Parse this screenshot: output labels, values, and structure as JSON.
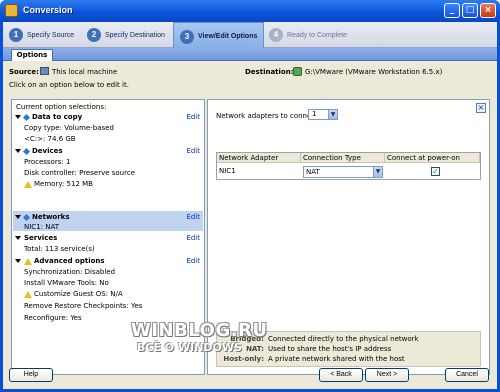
{
  "window": {
    "title": "Conversion"
  },
  "steps": [
    {
      "num": "1",
      "label": "Specify Source"
    },
    {
      "num": "2",
      "label": "Specify Destination"
    },
    {
      "num": "3",
      "label": "View/Edit Options"
    },
    {
      "num": "4",
      "label": "Ready to Complete"
    }
  ],
  "options_tab": "Options",
  "source": {
    "label": "Source:",
    "value": "This local machine"
  },
  "destination": {
    "label": "Destination:",
    "value": "G:\\VMware (VMware Workstation 6.5.x)"
  },
  "hint": "Click on an option below to edit it.",
  "left_panel": {
    "header": "Current option selections:",
    "edit_label": "Edit",
    "sections": {
      "data_to_copy": {
        "title": "Data to copy",
        "lines": [
          "Copy type: Volume-based",
          "<C:>: 74.6 GB"
        ]
      },
      "devices": {
        "title": "Devices",
        "lines": [
          "Processors: 1",
          "Disk controller: Preserve source",
          "Memory: 512 MB"
        ]
      },
      "networks": {
        "title": "Networks",
        "lines": [
          "NIC1: NAT"
        ]
      },
      "services": {
        "title": "Services",
        "lines": [
          "Total: 113 service(s)"
        ]
      },
      "advanced": {
        "title": "Advanced options",
        "lines": [
          "Synchronization: Disabled",
          "Install VMware Tools: No",
          "Customize Guest OS: N/A",
          "Remove Restore Checkpoints: Yes",
          "Reconfigure: Yes"
        ]
      }
    }
  },
  "right_panel": {
    "adapters_label": "Network adapters to connect:",
    "adapters_value": "1",
    "columns": [
      "Network Adapter",
      "Connection Type",
      "Connect at power-on"
    ],
    "rows": [
      {
        "adapter": "NIC1",
        "type": "NAT",
        "connect": true
      }
    ],
    "legend": [
      {
        "key": "Bridged:",
        "value": "Connected directly to the physical network"
      },
      {
        "key": "NAT:",
        "value": "Used to share the host's IP address"
      },
      {
        "key": "Host-only:",
        "value": "A private network shared with the host"
      }
    ]
  },
  "watermark": {
    "line1": "WINBLOG.RU",
    "line2": "ВСЁ О WINDOWS"
  },
  "buttons": {
    "help": "Help",
    "back": "< Back",
    "next": "Next >",
    "cancel": "Cancel"
  }
}
